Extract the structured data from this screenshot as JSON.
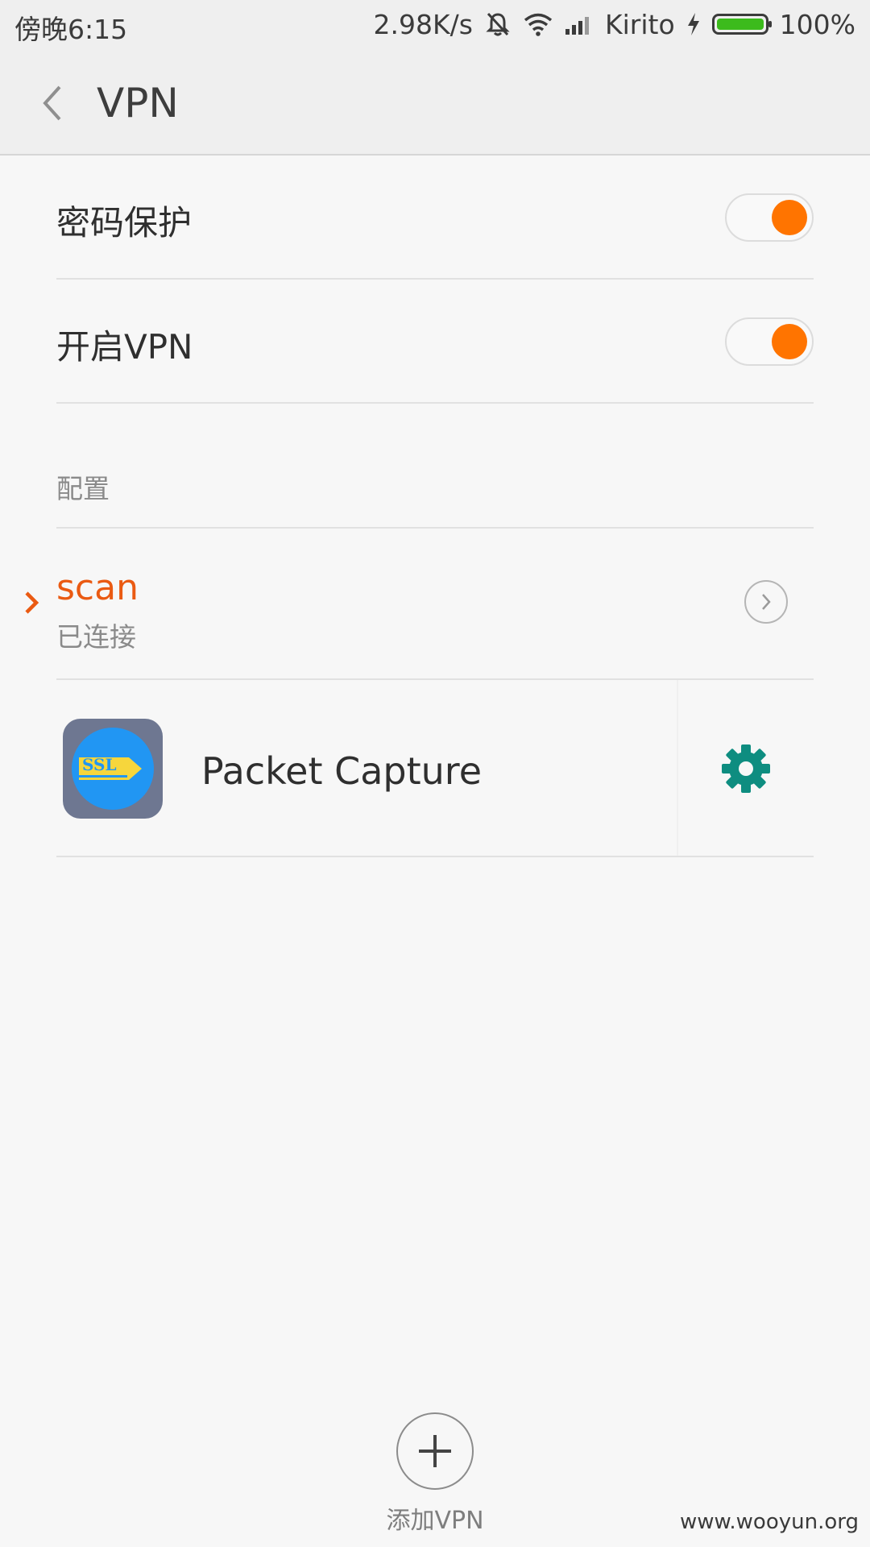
{
  "status_bar": {
    "time": "傍晚6:15",
    "network_speed": "2.98K/s",
    "carrier": "Kirito",
    "battery_percent": "100%",
    "battery_level": 1.0,
    "icons": [
      "notifications-off-icon",
      "wifi-icon",
      "signal-icon",
      "charging-icon",
      "battery-icon"
    ]
  },
  "header": {
    "title": "VPN",
    "back_icon": "chevron-left-icon"
  },
  "settings": {
    "password_protection": {
      "label": "密码保护",
      "enabled": true
    },
    "enable_vpn": {
      "label": "开启VPN",
      "enabled": true
    }
  },
  "profiles_section": {
    "label": "配置",
    "profiles": [
      {
        "name": "scan",
        "status": "已连接",
        "active": true
      }
    ]
  },
  "vpn_apps": [
    {
      "name": "Packet Capture",
      "icon_text": "SSL",
      "settings_icon": "gear-icon"
    }
  ],
  "footer": {
    "add_label": "添加VPN",
    "watermark": "www.wooyun.org"
  },
  "colors": {
    "accent": "#ff7400",
    "active_text": "#ea5a12",
    "gear": "#0e8d80",
    "battery": "#3cbb1c"
  }
}
